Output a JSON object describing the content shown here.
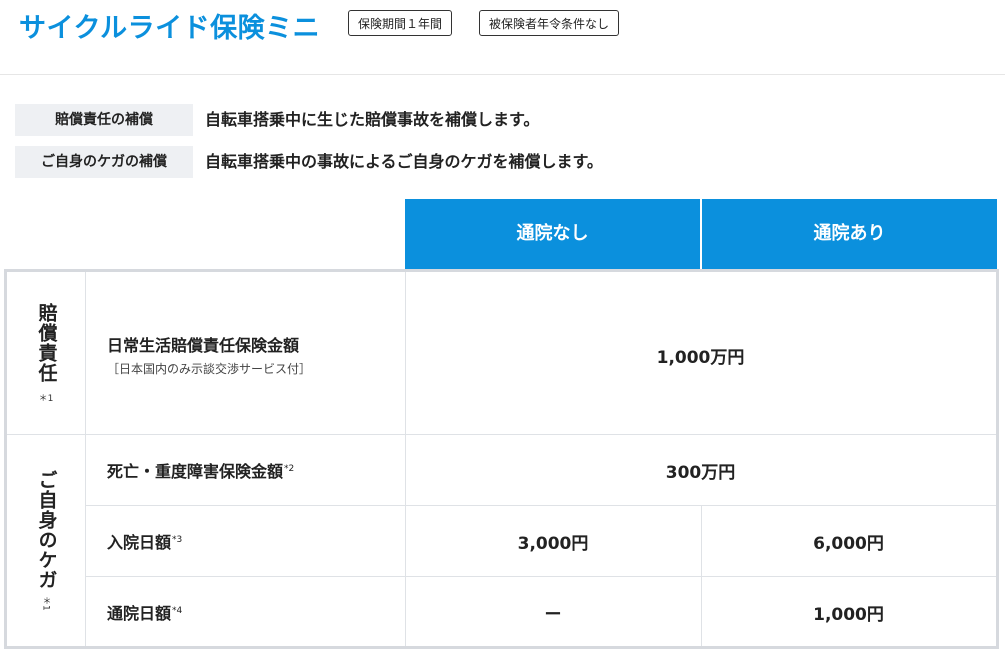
{
  "header": {
    "title": "サイクルライド保険ミニ",
    "badges": [
      "保険期間１年間",
      "被保険者年令条件なし"
    ]
  },
  "summary": [
    {
      "label": "賠償責任の補償",
      "text": "自転車搭乗中に生じた賠償事故を補償します。"
    },
    {
      "label": "ご自身のケガの補償",
      "text": "自転車搭乗中の事故によるご自身のケガを補償します。"
    }
  ],
  "columns": [
    "通院なし",
    "通院あり"
  ],
  "categories": [
    {
      "name": "賠償責任",
      "note": "＊1"
    },
    {
      "name": "ご自身のケガ",
      "note": "＊1"
    }
  ],
  "rows": [
    {
      "label": "日常生活賠償責任保険金額",
      "sup": "",
      "sub": "［日本国内のみ示談交渉サービス付］",
      "values": [
        "1,000万円"
      ]
    },
    {
      "label": "死亡・重度障害保険金額",
      "sup": "*2",
      "sub": "",
      "values": [
        "300万円"
      ]
    },
    {
      "label": "入院日額",
      "sup": "*3",
      "sub": "",
      "values": [
        "3,000円",
        "6,000円"
      ]
    },
    {
      "label": "通院日額",
      "sup": "*4",
      "sub": "",
      "values": [
        "ー",
        "1,000円"
      ]
    }
  ],
  "colors": {
    "accent": "#0b90dd",
    "label_bg": "#eef0f3",
    "border": "#d6d9de"
  }
}
